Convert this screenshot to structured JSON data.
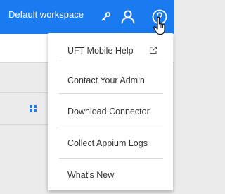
{
  "header": {
    "workspace_label": "Default workspace",
    "accent_color": "#1a7bf0",
    "icons": [
      "key-icon",
      "user-icon",
      "help-circle-icon"
    ]
  },
  "help_menu": {
    "items": [
      {
        "label": "UFT Mobile Help",
        "icon": "external-link-icon"
      },
      {
        "label": "Contact Your Admin"
      },
      {
        "label": "Download Connector"
      },
      {
        "label": "Collect Appium Logs"
      },
      {
        "label": "What's New"
      }
    ]
  }
}
